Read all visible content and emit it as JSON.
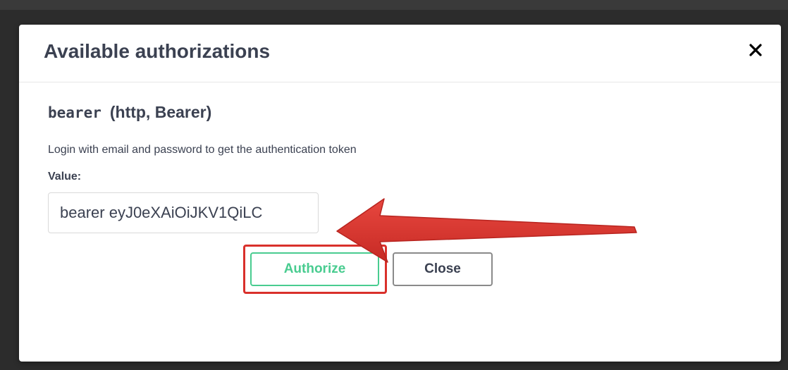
{
  "modal": {
    "title": "Available authorizations",
    "close_icon": "close-icon"
  },
  "scheme": {
    "name": "bearer",
    "type": "(http, Bearer)",
    "description": "Login with email and password to get the authentication token",
    "value_label": "Value:",
    "value": "bearer eyJ0eXAiOiJKV1QiLC"
  },
  "buttons": {
    "authorize_label": "Authorize",
    "close_label": "Close"
  },
  "annotation": {
    "arrow_icon": "arrow-left-icon",
    "arrow_color": "#d9302b",
    "highlight_color": "#d9302b"
  },
  "colors": {
    "authorize_accent": "#49cc90",
    "text": "#3b4151"
  }
}
